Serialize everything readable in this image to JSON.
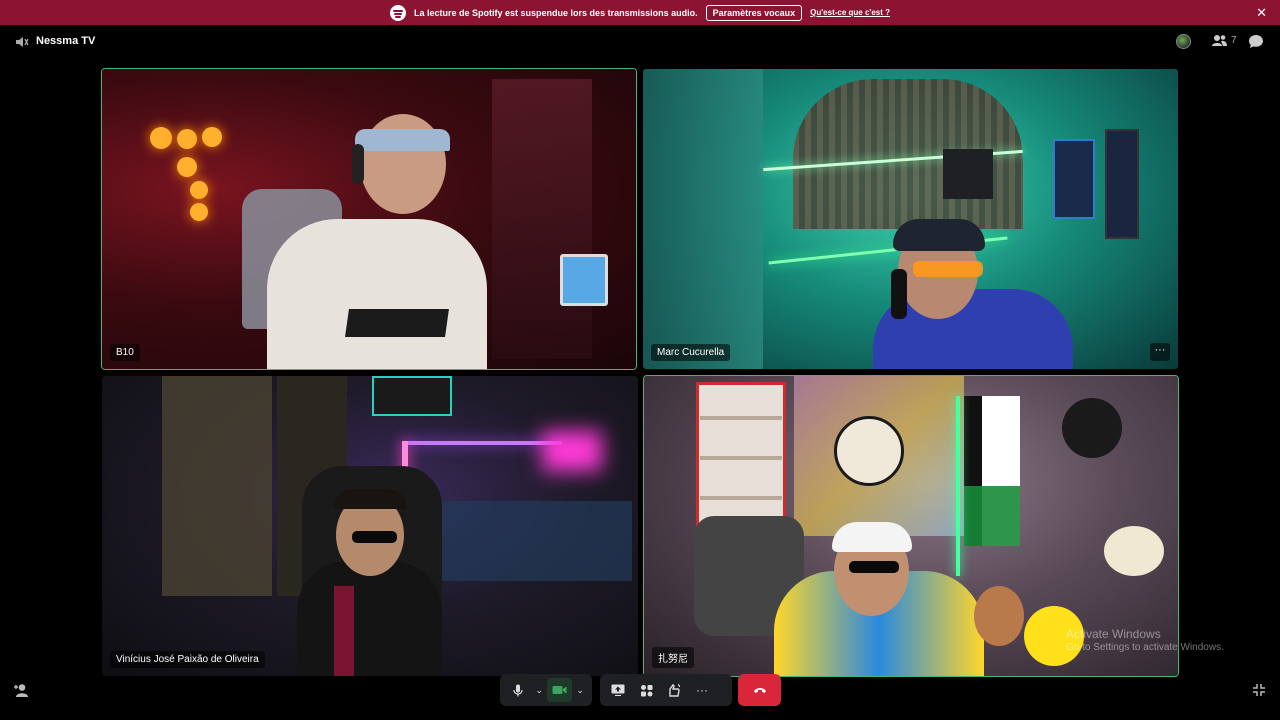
{
  "notice": {
    "message": "La lecture de Spotify est suspendue lors des transmissions audio.",
    "button_label": "Paramètres vocaux",
    "link_label": "Qu'est-ce que c'est ?",
    "close_glyph": "✕"
  },
  "header": {
    "channel_name": "Nessma TV",
    "participant_count": "7"
  },
  "participants": [
    {
      "name": "B10",
      "speaking": true
    },
    {
      "name": "Marc Cucurella",
      "speaking": false
    },
    {
      "name": "Vinícius José Paixão de Oliveira",
      "speaking": false
    },
    {
      "name": "扎努尼",
      "speaking": true
    }
  ],
  "tile_more_glyph": "···",
  "watermark": {
    "line1": "Activate Windows",
    "line2": "Go to Settings to activate Windows."
  },
  "controls": {
    "chevron": "⌄",
    "more_glyph": "···"
  },
  "colors": {
    "notice_bg": "#8c1433",
    "speaking_outline": "#43b581",
    "end_call": "#d9263b"
  }
}
